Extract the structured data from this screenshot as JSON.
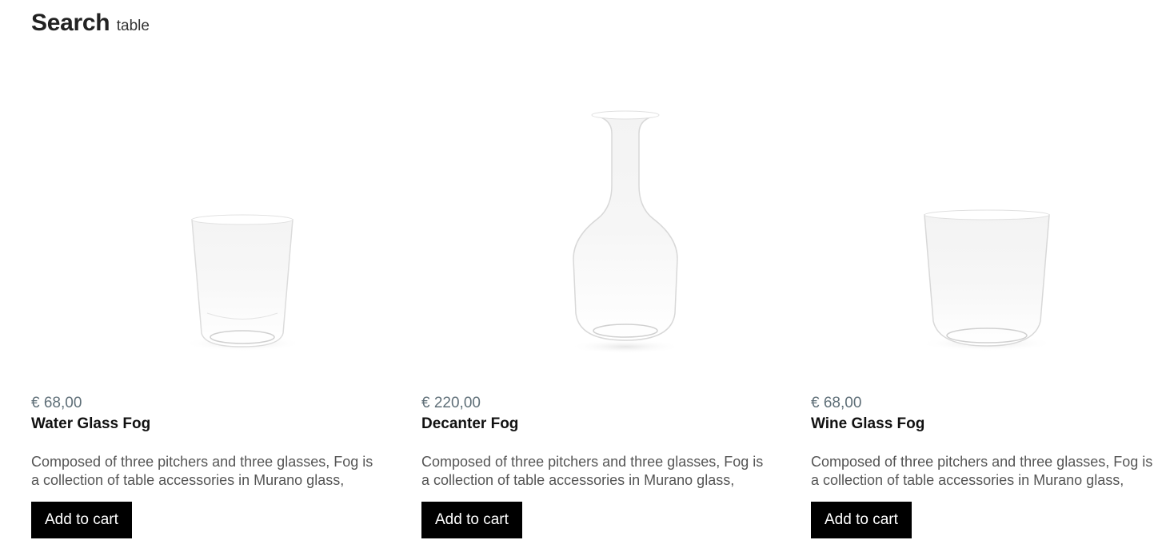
{
  "header": {
    "title": "Search",
    "query": "table"
  },
  "products": [
    {
      "price": "€ 68,00",
      "name": "Water Glass Fog",
      "description_line1": "Composed of three pitchers and three glasses, Fog is",
      "description_line2": "a collection of table accessories in Murano glass,",
      "button_label": "Add to cart",
      "image": "water-glass"
    },
    {
      "price": "€ 220,00",
      "name": "Decanter Fog",
      "description_line1": "Composed of three pitchers and three glasses, Fog is",
      "description_line2": "a collection of table accessories in Murano glass,",
      "button_label": "Add to cart",
      "image": "decanter"
    },
    {
      "price": "€ 68,00",
      "name": "Wine Glass Fog",
      "description_line1": "Composed of three pitchers and three glasses, Fog is",
      "description_line2": "a collection of table accessories in Murano glass,",
      "button_label": "Add to cart",
      "image": "wine-glass"
    }
  ],
  "colors": {
    "price": "#5f6f78",
    "button_bg": "#000000",
    "button_text": "#ffffff"
  }
}
